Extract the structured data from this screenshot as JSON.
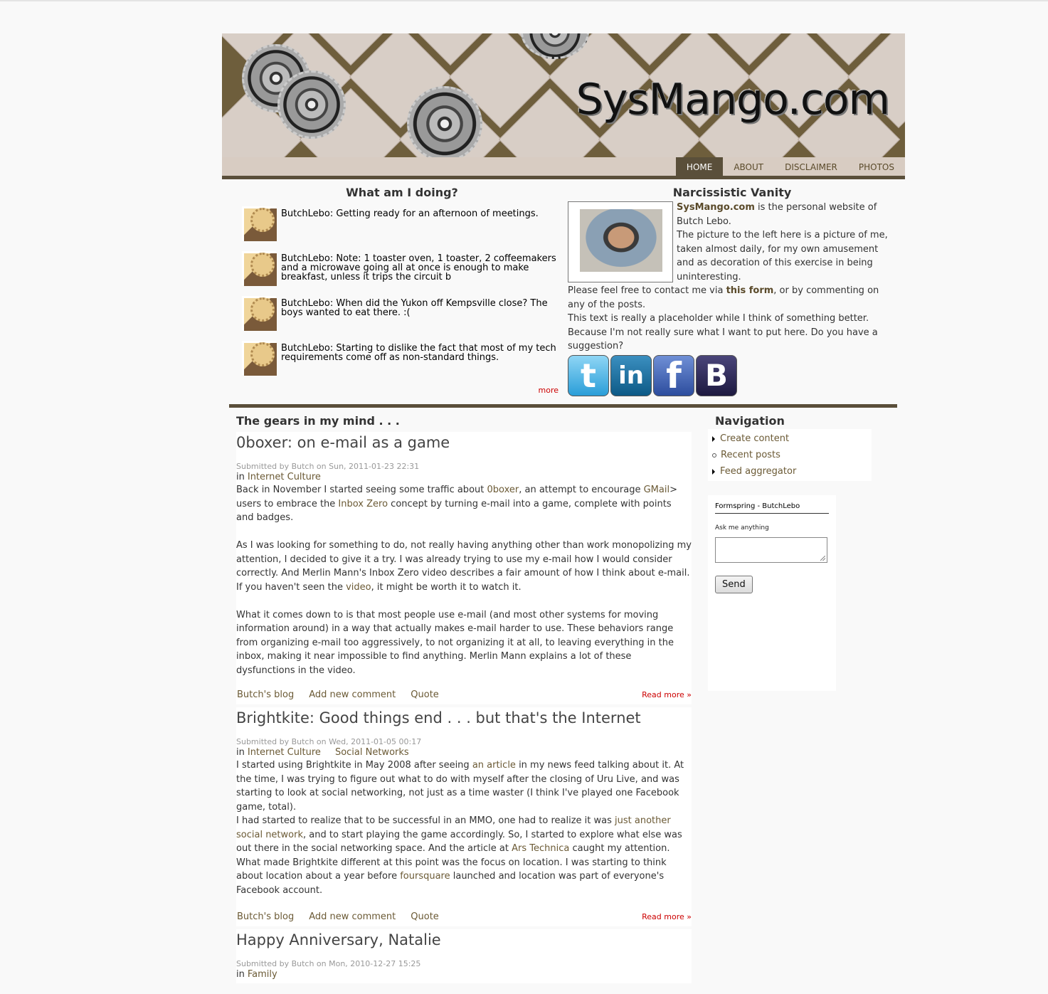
{
  "site": {
    "title": "SysMango.com"
  },
  "nav": {
    "tabs": [
      {
        "label": "HOME",
        "active": true
      },
      {
        "label": "ABOUT",
        "active": false
      },
      {
        "label": "DISCLAIMER",
        "active": false
      },
      {
        "label": "PHOTOS",
        "active": false
      }
    ]
  },
  "twitter": {
    "title": "What am I doing?",
    "tweets": [
      "ButchLebo: Getting ready for an afternoon of meetings.",
      "ButchLebo: Note: 1 toaster oven, 1 toaster, 2 coffeemakers and a microwave going all at once is enough to make breakfast, unless it trips the circuit b",
      "ButchLebo: When did the Yukon off Kempsville close? The boys wanted to eat there. :(",
      "ButchLebo: Starting to dislike the fact that most of my tech requirements come off as non-standard things."
    ],
    "more": "more"
  },
  "vanity": {
    "title": "Narcissistic Vanity",
    "site_link": "SysMango.com",
    "line1_rest": " is the personal website of Butch Lebo.",
    "line2": "The picture to the left here is a picture of me, taken almost daily, for my own amusement and as decoration of this exercise in being uninteresting.",
    "contact_pre": "Please feel free to contact me via ",
    "contact_link": "this form",
    "contact_post": ", or by commenting on any of the posts.",
    "line4": "This text is really a placeholder while I think of something better. Because I'm not really sure what I want to put here. Do you have a suggestion?",
    "social": [
      {
        "icon": "twitter-icon",
        "glyph": "t",
        "color": "#3aa9e0"
      },
      {
        "icon": "linkedin-icon",
        "glyph": "in",
        "color": "#1a6c9c"
      },
      {
        "icon": "facebook-icon",
        "glyph": "f",
        "color": "#3b5aa8"
      },
      {
        "icon": "blogger-icon",
        "glyph": "B",
        "color": "#2a2550"
      }
    ]
  },
  "main": {
    "section_title": "The gears in my mind . . .",
    "posts": [
      {
        "title": "0boxer: on e-mail as a game",
        "submitted": "Submitted by Butch on Sun, 2011-01-23 22:31",
        "in_label": "in",
        "terms": [
          "Internet Culture"
        ],
        "p1_a": "Back in November I started seeing some traffic about ",
        "p1_link1": "0boxer",
        "p1_b": ", an attempt to encourage ",
        "p1_link2": "GMail",
        "p1_c": "> users to embrace the ",
        "p1_link3": "Inbox Zero",
        "p1_d": " concept by turning e-mail into a game, complete with points and badges.",
        "p2_a": "As I was looking for something to do, not really having anything other than work monopolizing my attention, I decided to give it a try. I was already trying to use my e-mail how I would consider correctly. And Merlin Mann's Inbox Zero video describes a fair amount of how I think about e-mail. If you haven't seen the ",
        "p2_link": "video",
        "p2_b": ", it might be worth it to watch it.",
        "p3": "What it comes down to is that most people use e-mail (and most other systems for moving information around) in a way that actually makes e-mail harder to use. These behaviors range from organizing e-mail too aggressively, to not organizing it at all, to leaving everything in the inbox, making it near impossible to find anything. Merlin Mann explains a lot of these dysfunctions in the video.",
        "links": [
          "Butch's blog",
          "Add new comment",
          "Quote"
        ],
        "read_more": "Read more »"
      },
      {
        "title": "Brightkite: Good things end . . . but that's the Internet",
        "submitted": "Submitted by Butch on Wed, 2011-01-05 00:17",
        "in_label": "in",
        "terms": [
          "Internet Culture",
          "Social Networks"
        ],
        "p1_a": "I started using Brightkite in May 2008 after seeing ",
        "p1_link1": "an article",
        "p1_b": " in my news feed talking about it. At the time, I was trying to figure out what to do with myself after the closing of Uru Live, and was starting to look at social networking, not just as a time waster (I think I've played one Facebook game, total).",
        "p2_a": "I had started to realize that to be successful in an MMO, one had to realize it was ",
        "p2_link1": "just another social network",
        "p2_b": ", and to start playing the game accordingly. So, I started to explore what else was out there in the social networking space. And the article at ",
        "p2_link2": "Ars Technica",
        "p2_c": " caught my attention.",
        "p3_a": "What made Brightkite different at this point was the focus on location. I was starting to think about location about a year before ",
        "p3_link": "foursquare",
        "p3_b": " launched and location was part of everyone's Facebook account.",
        "links": [
          "Butch's blog",
          "Add new comment",
          "Quote"
        ],
        "read_more": "Read more »"
      },
      {
        "title": "Happy Anniversary, Natalie",
        "submitted": "Submitted by Butch on Mon, 2010-12-27 15:25",
        "in_label": "in",
        "terms": [
          "Family"
        ]
      }
    ]
  },
  "sidebar": {
    "nav_title": "Navigation",
    "nav_items": [
      "Create content",
      "Recent posts",
      "Feed aggregator"
    ],
    "formspring": {
      "head": "Formspring - ButchLebo",
      "label": "Ask me anything",
      "send": "Send"
    }
  }
}
